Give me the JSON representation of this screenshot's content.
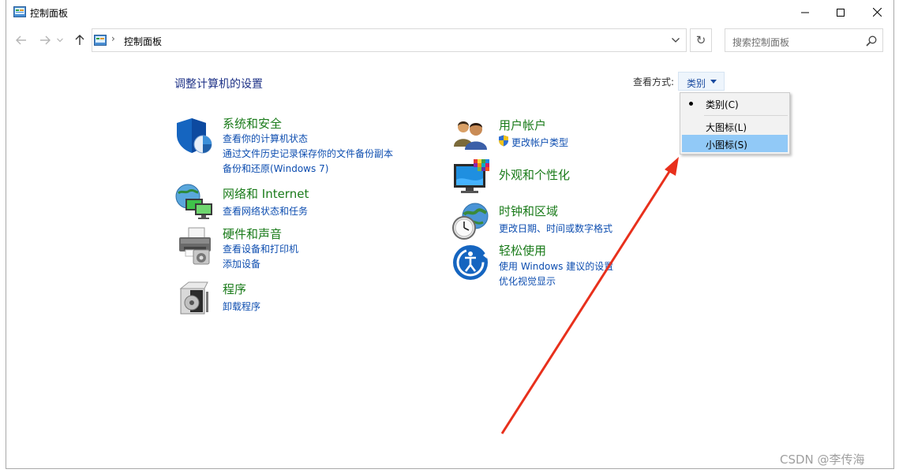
{
  "window": {
    "title": "控制面板",
    "controls": [
      "minimize",
      "maximize",
      "close"
    ]
  },
  "navbar": {
    "address_separator": "›",
    "address_text": "控制面板",
    "refresh_glyph": "↻",
    "search_placeholder": "搜索控制面板"
  },
  "main": {
    "heading": "调整计算机的设置",
    "view_by_label": "查看方式:",
    "view_by_value": "类别"
  },
  "view_menu": {
    "items": [
      {
        "label": "类别(C)",
        "selected": true
      },
      {
        "label": "大图标(L)",
        "selected": false
      },
      {
        "label": "小图标(S)",
        "selected": false,
        "highlighted": true
      }
    ]
  },
  "categories_left": [
    {
      "icon": "shield-icon",
      "title": "系统和安全",
      "links": [
        "查看你的计算机状态",
        "通过文件历史记录保存你的文件备份副本",
        "备份和还原(Windows 7)"
      ]
    },
    {
      "icon": "network-globe-icon",
      "title": "网络和 Internet",
      "links": [
        "查看网络状态和任务"
      ]
    },
    {
      "icon": "printer-icon",
      "title": "硬件和声音",
      "links": [
        "查看设备和打印机",
        "添加设备"
      ]
    },
    {
      "icon": "programs-icon",
      "title": "程序",
      "links": [
        "卸载程序"
      ]
    }
  ],
  "categories_right": [
    {
      "icon": "users-icon",
      "title": "用户帐户",
      "links": [
        "更改帐户类型"
      ]
    },
    {
      "icon": "display-palette-icon",
      "title": "外观和个性化",
      "links": []
    },
    {
      "icon": "clock-globe-icon",
      "title": "时钟和区域",
      "links": [
        "更改日期、时间或数字格式"
      ]
    },
    {
      "icon": "ease-of-access-icon",
      "title": "轻松使用",
      "links": [
        "使用 Windows 建议的设置",
        "优化视觉显示"
      ]
    }
  ],
  "watermark": "CSDN @李传海",
  "colors": {
    "category_title": "#1a7b1a",
    "link": "#0e4eb0",
    "heading": "#1e3287",
    "menu_highlight": "#91c9f7",
    "annotation_arrow": "#e8301c"
  }
}
